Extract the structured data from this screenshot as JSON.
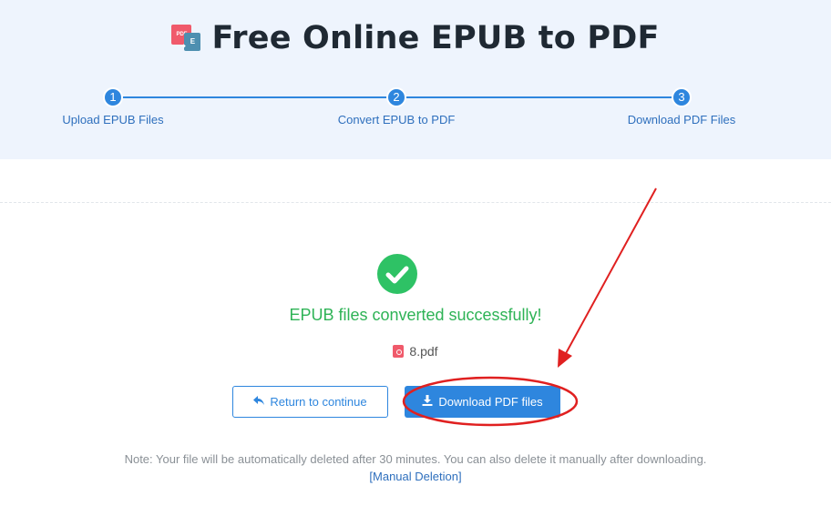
{
  "header": {
    "title": "Free Online EPUB to PDF",
    "logo_pdf": "PDF",
    "logo_epub": "E"
  },
  "steps": [
    {
      "number": "1",
      "label": "Upload EPUB Files"
    },
    {
      "number": "2",
      "label": "Convert EPUB to PDF"
    },
    {
      "number": "3",
      "label": "Download PDF Files"
    }
  ],
  "result": {
    "message": "EPUB files converted successfully!",
    "file_name": "8.pdf"
  },
  "buttons": {
    "return_label": "Return to continue",
    "download_label": "Download PDF files"
  },
  "note": {
    "text": "Note: Your file will be automatically deleted after 30 minutes. You can also delete it manually after downloading.",
    "link": "[Manual Deletion]"
  },
  "colors": {
    "accent": "#2e86de",
    "success": "#2eb356",
    "annotation": "#e02020"
  },
  "icons": {
    "check": "check-circle-icon",
    "return": "reply-arrow-icon",
    "download": "download-icon",
    "file": "pdf-file-icon"
  }
}
